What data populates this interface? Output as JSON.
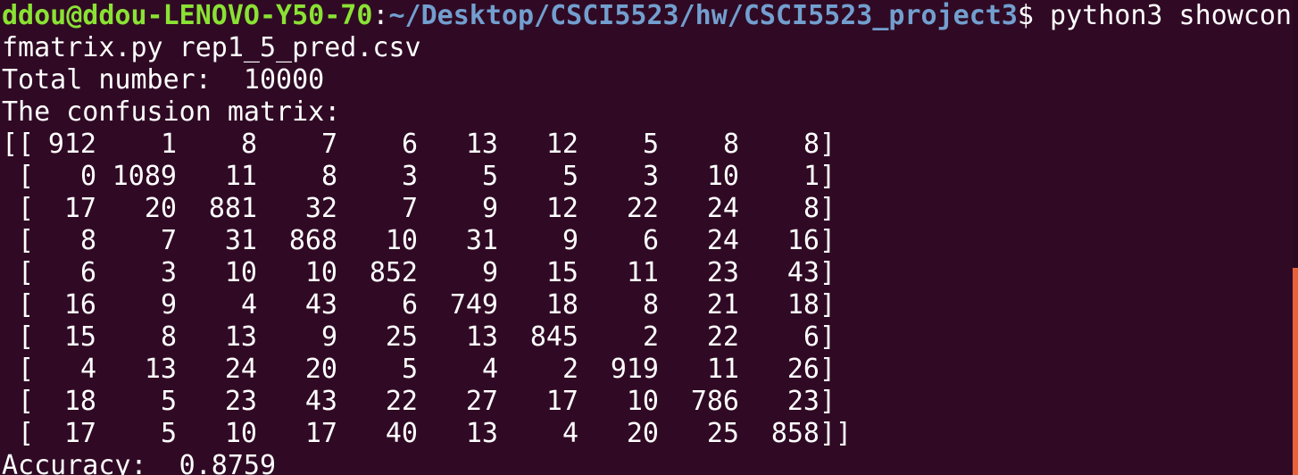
{
  "prompt": {
    "user_host": "ddou@ddou-LENOVO-Y50-70",
    "colon": ":",
    "path": "~/Desktop/CSCI5523/hw/CSCI5523_project3",
    "dollar": "$",
    "command": " python3 showcon",
    "command_wrap": "fmatrix.py rep1_5_pred.csv"
  },
  "output": {
    "total_line": "Total number:  10000",
    "matrix_heading": "The confusion matrix:",
    "accuracy_line": "Accuracy:  0.8759"
  },
  "matrix": [
    [
      "912",
      "1",
      "8",
      "7",
      "6",
      "13",
      "12",
      "5",
      "8",
      "8"
    ],
    [
      "0",
      "1089",
      "11",
      "8",
      "3",
      "5",
      "5",
      "3",
      "10",
      "1"
    ],
    [
      "17",
      "20",
      "881",
      "32",
      "7",
      "9",
      "12",
      "22",
      "24",
      "8"
    ],
    [
      "8",
      "7",
      "31",
      "868",
      "10",
      "31",
      "9",
      "6",
      "24",
      "16"
    ],
    [
      "6",
      "3",
      "10",
      "10",
      "852",
      "9",
      "15",
      "11",
      "23",
      "43"
    ],
    [
      "16",
      "9",
      "4",
      "43",
      "6",
      "749",
      "18",
      "8",
      "21",
      "18"
    ],
    [
      "15",
      "8",
      "13",
      "9",
      "25",
      "13",
      "845",
      "2",
      "22",
      "6"
    ],
    [
      "4",
      "13",
      "24",
      "20",
      "5",
      "4",
      "2",
      "919",
      "11",
      "26"
    ],
    [
      "18",
      "5",
      "23",
      "43",
      "22",
      "27",
      "17",
      "10",
      "786",
      "23"
    ],
    [
      "17",
      "5",
      "10",
      "17",
      "40",
      "13",
      "4",
      "20",
      "25",
      "858"
    ]
  ]
}
